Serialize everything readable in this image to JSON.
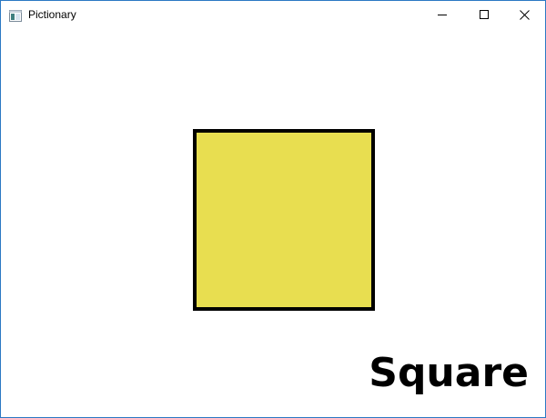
{
  "window": {
    "title": "Pictionary",
    "icon": "app-window-icon",
    "controls": {
      "minimize_icon": "minimize-icon",
      "maximize_icon": "maximize-icon",
      "close_icon": "close-icon"
    },
    "border_color": "#2b79c4"
  },
  "drawing": {
    "shape": "square",
    "fill_color": "#e8de50",
    "outline_color": "#000000",
    "label": "Square"
  }
}
